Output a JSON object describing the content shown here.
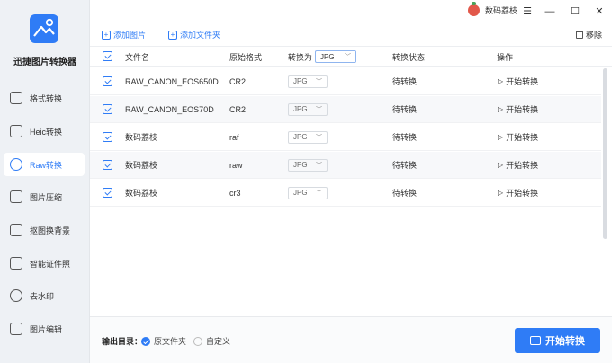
{
  "app": {
    "name": "迅捷图片转换器",
    "brand": "数码荔枝"
  },
  "colors": {
    "accent": "#2f7cf6",
    "sidebar_bg": "#eef1f5"
  },
  "window": {
    "minimize": "—",
    "restore": "☐",
    "close": "✕",
    "menu": "☰"
  },
  "sidebar": {
    "items": [
      {
        "label": "格式转换",
        "icon": "format-convert-icon",
        "active": false
      },
      {
        "label": "Heic转换",
        "icon": "heic-icon",
        "active": false
      },
      {
        "label": "Raw转换",
        "icon": "raw-icon",
        "active": true
      },
      {
        "label": "图片压缩",
        "icon": "compress-icon",
        "active": false
      },
      {
        "label": "抠图换背景",
        "icon": "cutout-icon",
        "active": false
      },
      {
        "label": "智能证件照",
        "icon": "id-photo-icon",
        "active": false
      },
      {
        "label": "去水印",
        "icon": "watermark-icon",
        "active": false
      },
      {
        "label": "图片编辑",
        "icon": "edit-image-icon",
        "active": false
      }
    ]
  },
  "toolbar": {
    "add_image": "添加图片",
    "add_folder": "添加文件夹",
    "remove": "移除"
  },
  "table": {
    "headers": {
      "filename": "文件名",
      "format": "原始格式",
      "convert_to": "转换为",
      "status": "转换状态",
      "action": "操作"
    },
    "convert_to_value": "JPG",
    "rows": [
      {
        "name": "RAW_CANON_EOS650D",
        "format": "CR2",
        "target": "JPG",
        "status": "待转换",
        "action": "开始转换"
      },
      {
        "name": "RAW_CANON_EOS70D",
        "format": "CR2",
        "target": "JPG",
        "status": "待转换",
        "action": "开始转换"
      },
      {
        "name": "数码荔枝",
        "format": "raf",
        "target": "JPG",
        "status": "待转换",
        "action": "开始转换"
      },
      {
        "name": "数码荔枝",
        "format": "raw",
        "target": "JPG",
        "status": "待转换",
        "action": "开始转换"
      },
      {
        "name": "数码荔枝",
        "format": "cr3",
        "target": "JPG",
        "status": "待转换",
        "action": "开始转换"
      }
    ]
  },
  "footer": {
    "output_label": "输出目录：",
    "option_original": "原文件夹",
    "option_custom": "自定义",
    "start_button": "开始转换"
  }
}
